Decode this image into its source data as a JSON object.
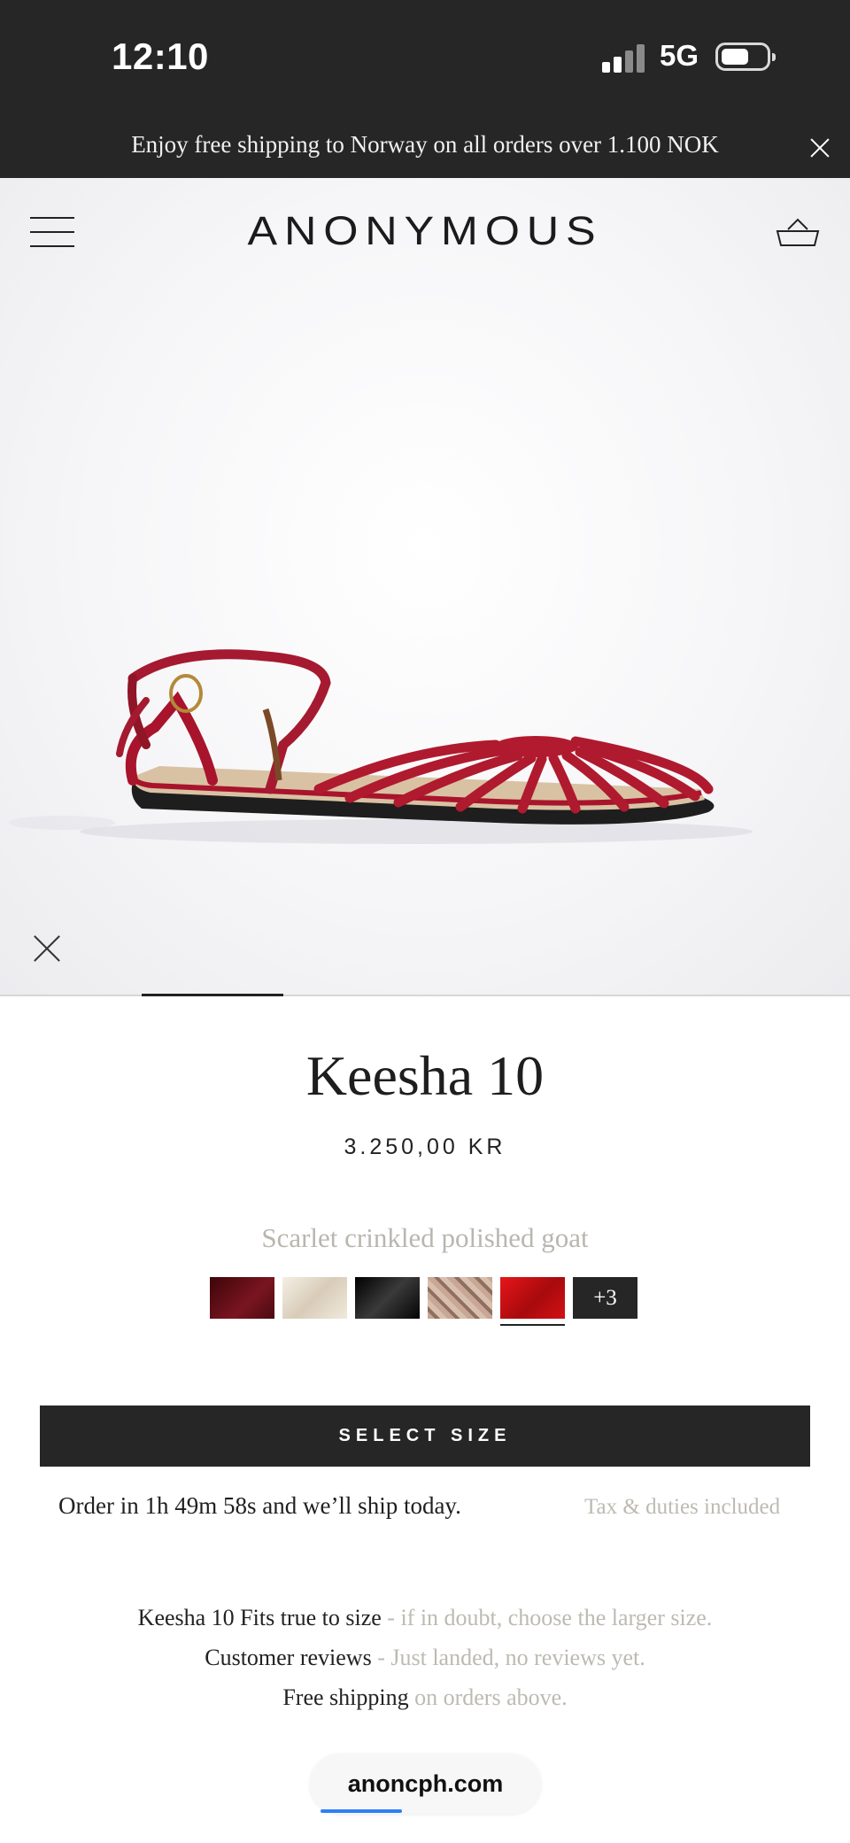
{
  "status_bar": {
    "time": "12:10",
    "network": "5G"
  },
  "announcement": {
    "text": "Enjoy free shipping to Norway on all orders over 1.100 NOK"
  },
  "header": {
    "logo": "ANONYMOUS"
  },
  "product": {
    "title": "Keesha 10",
    "price": "3.250,00 KR",
    "variant_name": "Scarlet crinkled polished goat",
    "swatches": [
      {
        "name": "burgundy",
        "color": "#5e0d14"
      },
      {
        "name": "cream",
        "color": "#ebe4d6"
      },
      {
        "name": "black",
        "color": "#111111"
      },
      {
        "name": "snake-print",
        "color": "#b89a86"
      },
      {
        "name": "scarlet",
        "color": "#c40f12",
        "selected": true
      }
    ],
    "more_swatches_label": "+3",
    "select_size_label": "SELECT SIZE",
    "ship_countdown": "Order in 1h 49m 58s and we’ll ship today.",
    "tax_note": "Tax & duties included"
  },
  "details": [
    {
      "label": "Keesha 10 Fits true to size",
      "note": " - if in doubt, choose the larger size."
    },
    {
      "label": "Customer reviews",
      "note": " - Just landed, no reviews yet."
    },
    {
      "label": "Free shipping",
      "note": " on orders above."
    }
  ],
  "browser": {
    "url": "anoncph.com"
  },
  "colors": {
    "dark": "#262626",
    "muted": "#bdbab2",
    "accent_blue": "#2d7ff9"
  }
}
